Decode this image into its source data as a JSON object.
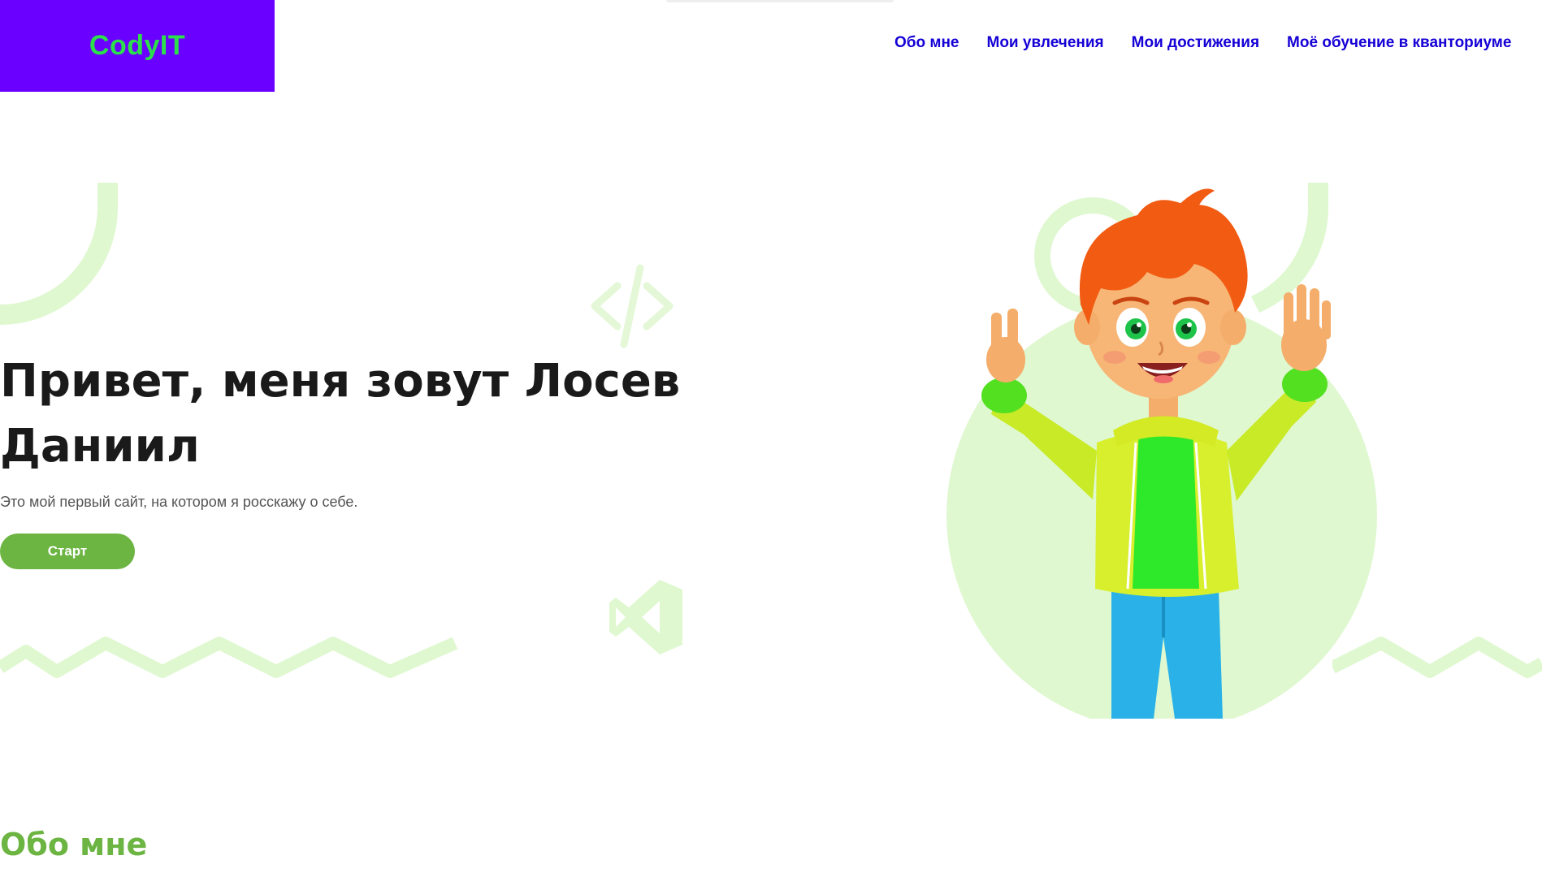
{
  "header": {
    "logo": "CodyIT",
    "nav": [
      "Обо мне",
      "Мои увлечения",
      "Мои достижения",
      "Моё обучение в кванториуме"
    ]
  },
  "hero": {
    "title": "Привет, меня зовут Лосев Даниил",
    "subtitle": "Это мой первый сайт, на котором я росскажу о себе.",
    "button": "Старт"
  },
  "sections": {
    "about_title": "Обо мне"
  },
  "colors": {
    "logo_bg": "#6a00ff",
    "logo_text": "#2be04a",
    "nav_link": "#1500d6",
    "accent_green": "#6cb542",
    "decor_green": "#dff8d0"
  },
  "icons": [
    "code-tag-icon",
    "vscode-icon"
  ]
}
